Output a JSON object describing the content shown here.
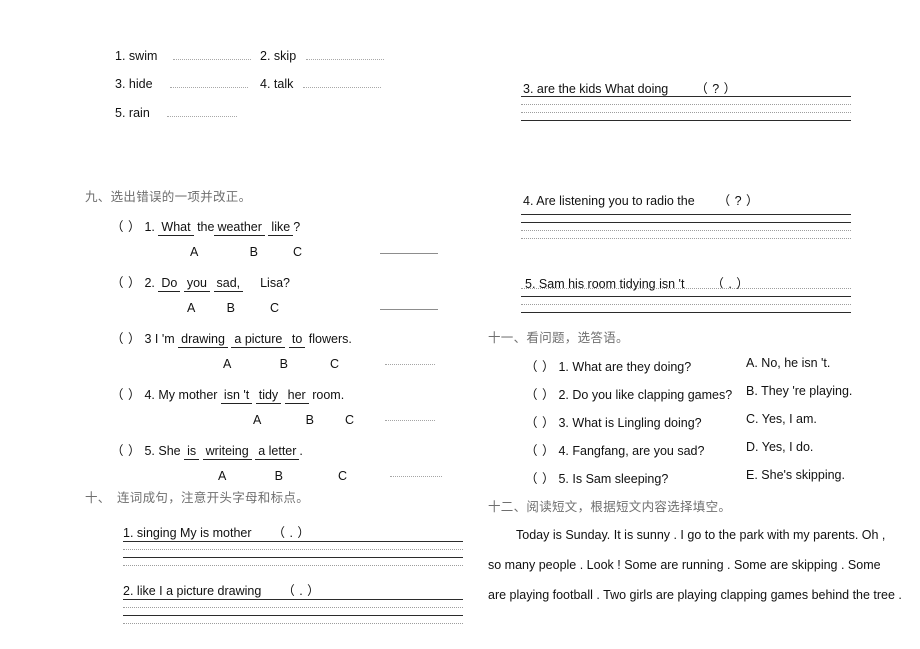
{
  "document": {
    "type": "english-worksheet",
    "heading_color": "#6f6f6f",
    "text_color": "#111111",
    "rule_dark_color": "#2b2b2b",
    "rule_light_color": "#9d9d9d"
  },
  "word_blanks": {
    "items": [
      {
        "num": "1.",
        "word": "swim"
      },
      {
        "num": "2.",
        "word": "skip"
      },
      {
        "num": "3.",
        "word": "hide"
      },
      {
        "num": "4.",
        "word": "talk"
      },
      {
        "num": "5.",
        "word": "rain"
      }
    ]
  },
  "section_nine": {
    "heading": "九、选出错误的一项并改正。",
    "items": [
      {
        "bracket": "（    ）",
        "num": "1.",
        "parts": [
          {
            "text": "What",
            "underlined": true
          },
          {
            "text": "the",
            "underlined": false
          },
          {
            "text": "weather",
            "underlined": true
          },
          {
            "text": "like",
            "underlined": true
          },
          {
            "text": "?",
            "underlined": false
          }
        ],
        "labels": [
          "A",
          "B",
          "C"
        ]
      },
      {
        "bracket": "（    ）",
        "num": "2.",
        "parts": [
          {
            "text": "Do",
            "underlined": true
          },
          {
            "text": "you",
            "underlined": true
          },
          {
            "text": "sad,",
            "underlined": true
          },
          {
            "text": "Lisa?",
            "underlined": false
          }
        ],
        "labels": [
          "A",
          "B",
          "C"
        ]
      },
      {
        "bracket": "（    ）",
        "num": "3",
        "parts": [
          {
            "text": "I 'm",
            "underlined": false
          },
          {
            "text": "drawing",
            "underlined": true
          },
          {
            "text": "a picture",
            "underlined": true
          },
          {
            "text": "to",
            "underlined": true
          },
          {
            "text": "flowers.",
            "underlined": false
          }
        ],
        "labels": [
          "A",
          "B",
          "C"
        ]
      },
      {
        "bracket": "（    ）",
        "num": "4.",
        "parts": [
          {
            "text": "My mother",
            "underlined": false
          },
          {
            "text": "isn 't",
            "underlined": true
          },
          {
            "text": "tidy",
            "underlined": true
          },
          {
            "text": "her",
            "underlined": true
          },
          {
            "text": "room.",
            "underlined": false
          }
        ],
        "labels": [
          "A",
          "B",
          "C"
        ]
      },
      {
        "bracket": "（    ）",
        "num": "5.",
        "parts": [
          {
            "text": "She",
            "underlined": false
          },
          {
            "text": "is",
            "underlined": true
          },
          {
            "text": "writeing",
            "underlined": true
          },
          {
            "text": "a  letter",
            "underlined": true
          },
          {
            "text": ".",
            "underlined": false
          }
        ],
        "labels": [
          "A",
          "B",
          "C"
        ]
      }
    ]
  },
  "section_ten": {
    "heading_num": "十、",
    "heading": "连词成句，注意开头字母和标点。",
    "items": [
      {
        "num": "1.",
        "words": "singing        My        is       mother",
        "punct": "（ . ）"
      },
      {
        "num": "2.",
        "words": "like       I      a     picture     drawing",
        "punct": "（ . ）"
      },
      {
        "num": "3.",
        "words": "are     the    kids     What     doing",
        "punct": "（ ? ）"
      },
      {
        "num": "4.",
        "words": "Are     listening      you      to   radio    the",
        "punct": "（ ? ）"
      },
      {
        "num": "5.",
        "words": "Sam    his     room    tidying        isn 't",
        "punct": "（ . ）"
      }
    ]
  },
  "section_eleven": {
    "heading": "十一、看问题，选答语。",
    "questions": [
      {
        "bracket": "（    ）",
        "num": "1.",
        "text": "What are they doing?"
      },
      {
        "bracket": "（    ）",
        "num": "2.",
        "text": "Do you like clapping games?"
      },
      {
        "bracket": "（    ）",
        "num": "3.",
        "text": "What is Lingling doing?"
      },
      {
        "bracket": "（    ）",
        "num": "4.",
        "text": "Fangfang, are you sad?"
      },
      {
        "bracket": "（    ）",
        "num": "5.",
        "text": "Is Sam sleeping?"
      }
    ],
    "answers": [
      {
        "letter": "A.",
        "text": "No, he isn 't."
      },
      {
        "letter": "B.",
        "text": "They 're playing."
      },
      {
        "letter": "C.",
        "text": "Yes, I am."
      },
      {
        "letter": "D.",
        "text": "Yes, I do."
      },
      {
        "letter": "E.",
        "text": "She's skipping."
      }
    ]
  },
  "section_twelve": {
    "heading": "十二、阅读短文，根据短文内容选择填空。",
    "passage_lines": [
      "Today is Sunday. It is sunny . I go to the park with my parents. Oh ,",
      "so many people . Look ! Some are running . Some are skipping . Some",
      "are playing football . Two girls are playing clapping games behind the tree ."
    ]
  }
}
